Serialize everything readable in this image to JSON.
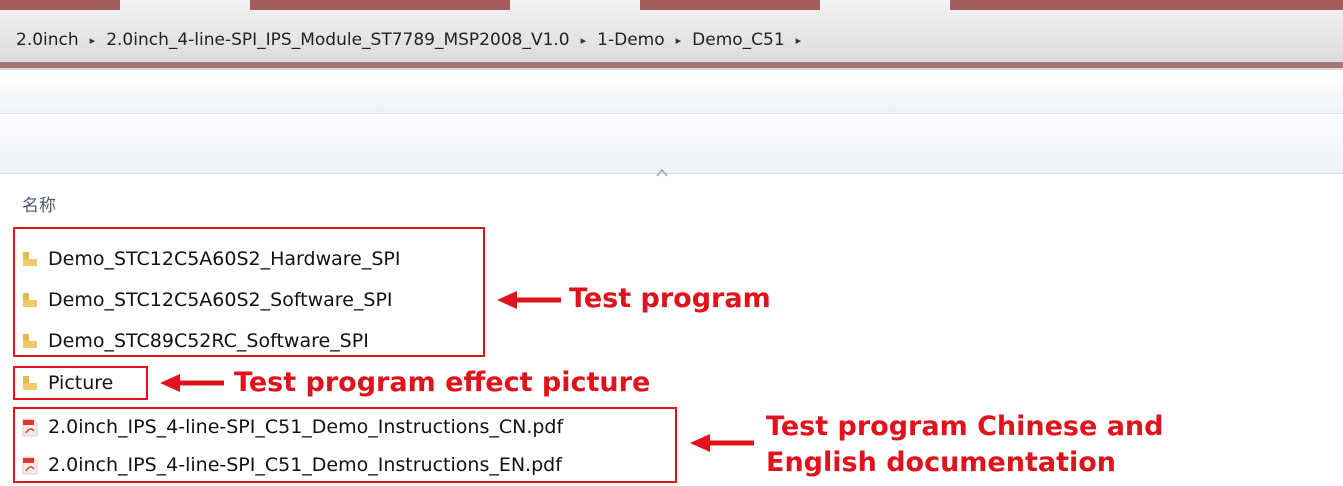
{
  "breadcrumb": {
    "items": [
      "2.0inch",
      "2.0inch_4-line-SPI_IPS_Module_ST7789_MSP2008_V1.0",
      "1-Demo",
      "Demo_C51"
    ],
    "separator": "▸"
  },
  "list": {
    "column_header": "名称",
    "files": [
      {
        "name": "Demo_STC12C5A60S2_Hardware_SPI",
        "icon": "folder-icon"
      },
      {
        "name": "Demo_STC12C5A60S2_Software_SPI",
        "icon": "folder-icon"
      },
      {
        "name": "Demo_STC89C52RC_Software_SPI",
        "icon": "folder-icon"
      },
      {
        "name": "Picture",
        "icon": "folder-icon"
      },
      {
        "name": "2.0inch_IPS_4-line-SPI_C51_Demo_Instructions_CN.pdf",
        "icon": "pdf-icon"
      },
      {
        "name": "2.0inch_IPS_4-line-SPI_C51_Demo_Instructions_EN.pdf",
        "icon": "pdf-icon"
      }
    ]
  },
  "annotations": {
    "test_program": "Test program",
    "effect_picture": "Test program effect picture",
    "docs_line1": "Test program Chinese and",
    "docs_line2": "English documentation"
  },
  "colors": {
    "annotation": "#e0121b",
    "folder": "#e8b84a",
    "pdf": "#d93a2b"
  }
}
